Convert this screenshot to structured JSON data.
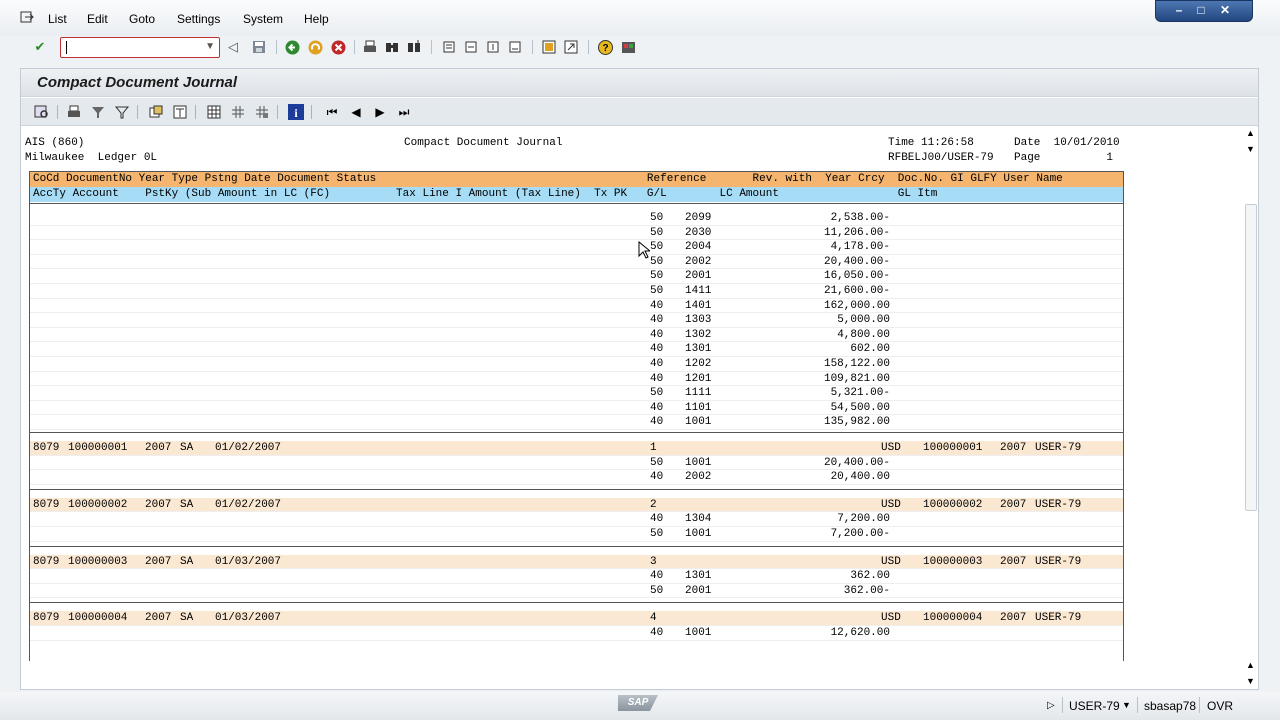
{
  "menubar": {
    "items": [
      {
        "label": "List"
      },
      {
        "label": "Edit"
      },
      {
        "label": "Goto"
      },
      {
        "label": "Settings"
      },
      {
        "label": "System"
      },
      {
        "label": "Help"
      }
    ]
  },
  "okcode": {
    "value": ""
  },
  "screen": {
    "title": "Compact Document Journal"
  },
  "report_header": {
    "company": "AIS (860)",
    "ledger": "Milwaukee  Ledger 0L",
    "center_title": "Compact Document Journal",
    "time": "Time 11:26:58",
    "date": "Date  10/01/2010",
    "program": "RFBELJ00/USER-79",
    "page": "Page          1"
  },
  "columns": {
    "row1": "CoCd DocumentNo Year Type Pstng Date Document Status                                         Reference       Rev. with  Year Crcy  Doc.No. GI GLFY User Name",
    "row2": "AccTy Account    PstKy (Sub Amount in LC (FC)          Tax Line I Amount (Tax Line)  Tx PK   G/L        LC Amount                  GL Itm"
  },
  "lines": [
    {
      "pk": "50",
      "gl": "2099",
      "amount": "2,538.00-"
    },
    {
      "pk": "50",
      "gl": "2030",
      "amount": "11,206.00-"
    },
    {
      "pk": "50",
      "gl": "2004",
      "amount": "4,178.00-"
    },
    {
      "pk": "50",
      "gl": "2002",
      "amount": "20,400.00-"
    },
    {
      "pk": "50",
      "gl": "2001",
      "amount": "16,050.00-"
    },
    {
      "pk": "50",
      "gl": "1411",
      "amount": "21,600.00-"
    },
    {
      "pk": "40",
      "gl": "1401",
      "amount": "162,000.00"
    },
    {
      "pk": "40",
      "gl": "1303",
      "amount": "5,000.00"
    },
    {
      "pk": "40",
      "gl": "1302",
      "amount": "4,800.00"
    },
    {
      "pk": "40",
      "gl": "1301",
      "amount": "602.00"
    },
    {
      "pk": "40",
      "gl": "1202",
      "amount": "158,122.00"
    },
    {
      "pk": "40",
      "gl": "1201",
      "amount": "109,821.00"
    },
    {
      "pk": "50",
      "gl": "1111",
      "amount": "5,321.00-"
    },
    {
      "pk": "40",
      "gl": "1101",
      "amount": "54,500.00"
    },
    {
      "pk": "40",
      "gl": "1001",
      "amount": "135,982.00"
    }
  ],
  "documents": [
    {
      "cocd": "8079",
      "docno": "100000001",
      "year": "2007",
      "type": "SA",
      "date": "01/02/2007",
      "ref": "1",
      "crcy": "USD",
      "docno2": "100000001",
      "glfy": "2007",
      "user": "USER-79",
      "items": [
        {
          "pk": "50",
          "gl": "1001",
          "amount": "20,400.00-"
        },
        {
          "pk": "40",
          "gl": "2002",
          "amount": "20,400.00"
        }
      ]
    },
    {
      "cocd": "8079",
      "docno": "100000002",
      "year": "2007",
      "type": "SA",
      "date": "01/02/2007",
      "ref": "2",
      "crcy": "USD",
      "docno2": "100000002",
      "glfy": "2007",
      "user": "USER-79",
      "items": [
        {
          "pk": "40",
          "gl": "1304",
          "amount": "7,200.00"
        },
        {
          "pk": "50",
          "gl": "1001",
          "amount": "7,200.00-"
        }
      ]
    },
    {
      "cocd": "8079",
      "docno": "100000003",
      "year": "2007",
      "type": "SA",
      "date": "01/03/2007",
      "ref": "3",
      "crcy": "USD",
      "docno2": "100000003",
      "glfy": "2007",
      "user": "USER-79",
      "items": [
        {
          "pk": "40",
          "gl": "1301",
          "amount": "362.00"
        },
        {
          "pk": "50",
          "gl": "2001",
          "amount": "362.00-"
        }
      ]
    },
    {
      "cocd": "8079",
      "docno": "100000004",
      "year": "2007",
      "type": "SA",
      "date": "01/03/2007",
      "ref": "4",
      "crcy": "USD",
      "docno2": "100000004",
      "glfy": "2007",
      "user": "USER-79",
      "items": [
        {
          "pk": "40",
          "gl": "1001",
          "amount": "12,620.00"
        }
      ]
    }
  ],
  "statusbar": {
    "logo": "SAP",
    "user": "USER-79",
    "server": "sbasap78",
    "mode": "OVR"
  },
  "colors": {
    "header_orange": "#f5b56e",
    "header_blue": "#a6dcf5",
    "doc_row": "#fbe8d2"
  }
}
